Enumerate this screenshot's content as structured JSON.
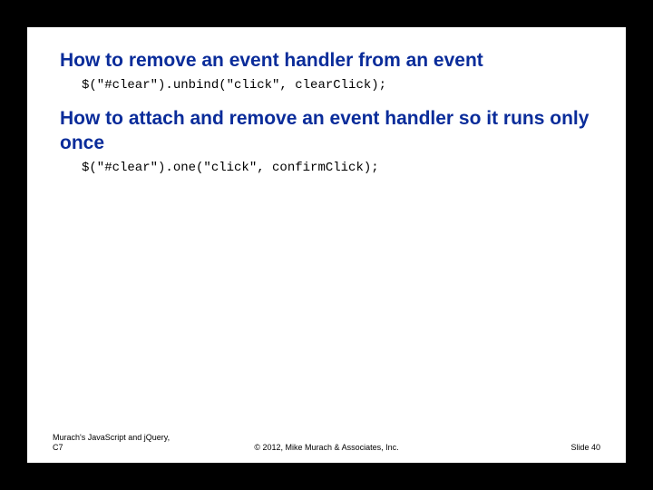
{
  "headings": {
    "h1": "How to remove an event handler from an event",
    "h2": "How to attach and remove an event handler so it runs only once"
  },
  "code": {
    "line1": "$(\"#clear\").unbind(\"click\", clearClick);",
    "line2": "$(\"#clear\").one(\"click\", confirmClick);"
  },
  "footer": {
    "left_line1": "Murach's JavaScript and jQuery,",
    "left_line2": "C7",
    "center": "© 2012, Mike Murach & Associates, Inc.",
    "right": "Slide 40"
  }
}
